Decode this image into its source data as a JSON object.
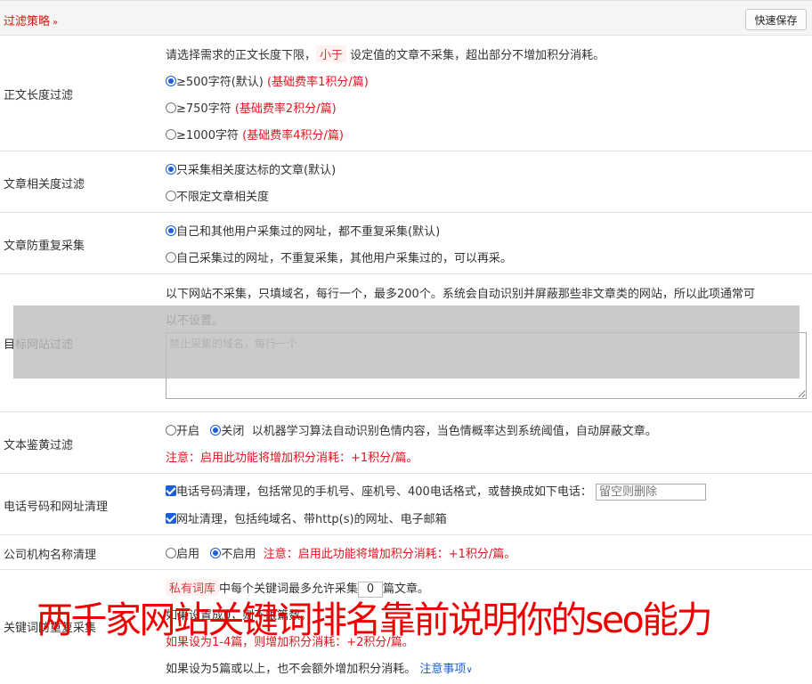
{
  "header": {
    "title": "过滤策略",
    "chevron": "»",
    "quick_save": "快速保存"
  },
  "length_filter": {
    "label": "正文长度过滤",
    "desc_pre": "请选择需求的正文长度下限，",
    "desc_pill": "小于",
    "desc_post": "设定值的文章不采集，超出部分不增加积分消耗。",
    "options": [
      {
        "text": "≥500字符(默认)",
        "rate": "(基础费率1积分/篇)",
        "checked": true
      },
      {
        "text": "≥750字符",
        "rate": "(基础费率2积分/篇)",
        "checked": false
      },
      {
        "text": "≥1000字符",
        "rate": "(基础费率4积分/篇)",
        "checked": false
      }
    ]
  },
  "relevance_filter": {
    "label": "文章相关度过滤",
    "options": [
      {
        "text": "只采集相关度达标的文章(默认)",
        "checked": true
      },
      {
        "text": "不限定文章相关度",
        "checked": false
      }
    ]
  },
  "dup_filter": {
    "label": "文章防重复采集",
    "options": [
      {
        "text": "自己和其他用户采集过的网址，都不重复采集(默认)",
        "checked": true
      },
      {
        "text": "自己采集过的网址，不重复采集，其他用户采集过的，可以再采。",
        "checked": false
      }
    ]
  },
  "site_filter": {
    "label": "目标网站过滤",
    "desc_line1": "以下网站不采集，只填域名，每行一个，最多200个。系统会自动识别并屏蔽那些非文章类的网站，所以此项通常可",
    "desc_line2": "以不设置。",
    "placeholder": "禁止采集的域名，每行一个"
  },
  "porn_filter": {
    "label": "文本鉴黄过滤",
    "on_label": "开启",
    "off_label": "关闭",
    "desc": "以机器学习算法自动识别色情内容，当色情概率达到系统阈值，自动屏蔽文章。",
    "note": "注意：启用此功能将增加积分消耗：+1积分/篇。"
  },
  "phone_clean": {
    "label": "电话号码和网址清理",
    "phone_text": "电话号码清理，包括常见的手机号、座机号、400电话格式，或替换成如下电话：",
    "phone_placeholder": "留空则删除",
    "url_text": "网址清理，包括纯域名、带http(s)的网址、电子邮箱"
  },
  "org_clean": {
    "label": "公司机构名称清理",
    "on_label": "启用",
    "off_label": "不启用",
    "note": "注意：启用此功能将增加积分消耗：+1积分/篇。"
  },
  "keyword_dup": {
    "label": "关键词防重复采集",
    "pill": "私有词库",
    "line1_mid": "中每个关键词最多允许采集",
    "count": "0",
    "line1_end": "篇文章。",
    "line2": "如果设置成0，则不限篇数。",
    "line3": "如果设为1-4篇，则增加积分消耗：+2积分/篇。",
    "line4": "如果设为5篇或以上，也不会额外增加积分消耗。",
    "notes_link": "注意事项"
  },
  "watermark": "两千家网站关键词排名靠前说明你的seo能力"
}
